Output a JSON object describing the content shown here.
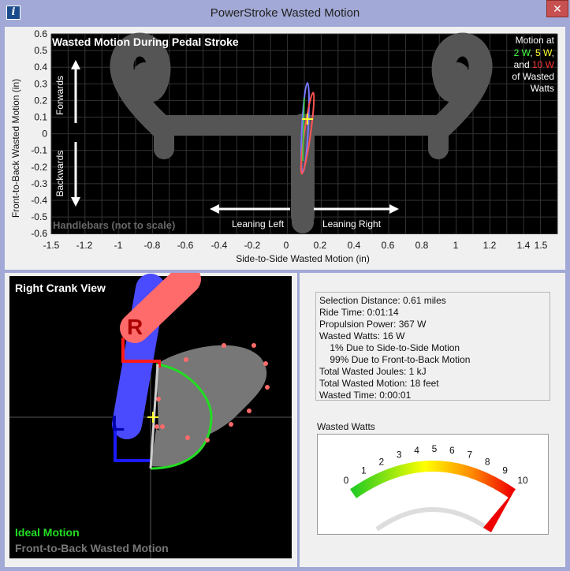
{
  "window": {
    "title": "PowerStroke Wasted Motion",
    "close_glyph": "✕",
    "icon_glyph": "i"
  },
  "top_plot": {
    "title": "Wasted Motion During Pedal Stroke",
    "xlabel": "Side-to-Side Wasted Motion (in)",
    "ylabel": "Front-to-Back Wasted Motion (in)",
    "x_ticks": [
      "-1.5",
      "-1.2",
      "-1",
      "-0.8",
      "-0.6",
      "-0.4",
      "-0.2",
      "0",
      "0.2",
      "0.4",
      "0.6",
      "0.8",
      "1",
      "1.2",
      "1.4",
      "1.5"
    ],
    "y_ticks": [
      "0.6",
      "0.5",
      "0.4",
      "0.3",
      "0.2",
      "0.1",
      "0",
      "-0.1",
      "-0.2",
      "-0.3",
      "-0.4",
      "-0.5",
      "-0.6"
    ],
    "forwards": "Forwards",
    "backwards": "Backwards",
    "leaning_left": "Leaning Left",
    "leaning_right": "Leaning Right",
    "handlebars_note": "Handlebars (not to scale)",
    "legend": {
      "line1": "Motion at",
      "w2": "2 W",
      "comma1": ",",
      "w5": "5 W",
      "comma2": ",",
      "and": "and",
      "w10": "10 W",
      "line3": "of Wasted",
      "line4": "Watts"
    },
    "colors": {
      "w2": "#44ff44",
      "w5": "#ffff33",
      "w10": "#ff3333",
      "bg": "#000000",
      "bars": "#555555"
    }
  },
  "crank_view": {
    "title": "Right Crank View",
    "r_label": "R",
    "l_label": "L",
    "ideal_label": "Ideal Motion",
    "wasted_label": "Front-to-Back Wasted Motion",
    "colors": {
      "right": "#ff6a6a",
      "left": "#4a4aff",
      "ideal": "#22dd22",
      "wasted": "#777777"
    }
  },
  "stats": [
    "Selection Distance: 0.61 miles",
    "Ride Time: 0:01:14",
    "Propulsion Power: 367 W",
    "Wasted Watts: 16 W",
    "    1% Due to Side-to-Side Motion",
    "    99% Due to Front-to-Back Motion",
    "Total Wasted Joules: 1 kJ",
    "Total Wasted Motion: 18 feet",
    "Wasted Time: 0:00:01"
  ],
  "gauge": {
    "label": "Wasted Watts",
    "ticks": [
      "0",
      "1",
      "2",
      "3",
      "4",
      "5",
      "6",
      "7",
      "8",
      "9",
      "10"
    ],
    "value": 16,
    "max": 10
  }
}
